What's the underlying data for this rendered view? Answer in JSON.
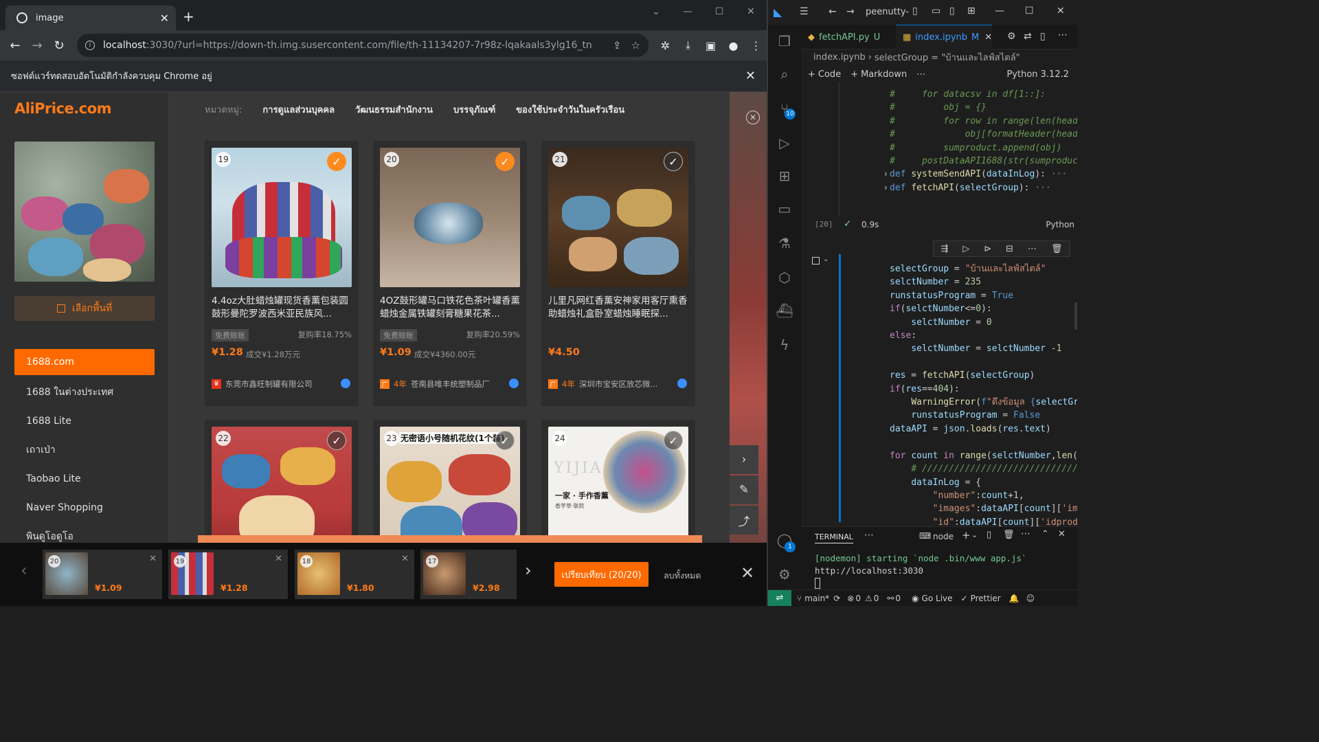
{
  "browser": {
    "tab_title": "image",
    "url_host": "localhost",
    "url_rest": ":3030/?url=https://down-th.img.susercontent.com/file/th-11134207-7r98z-lqakaals3ylg16_tn",
    "automation_notice": "ซอฟต์แวร์ทดสอบอัตโนมัติกำลังควบคุม Chrome อยู่"
  },
  "aliprice": {
    "logo": "AliPrice.com",
    "select_area_label": "เลือกพื้นที่",
    "sources": [
      "1688.com",
      "1688 ในต่างประเทศ",
      "1688 Lite",
      "เถาเป่า",
      "Taobao Lite",
      "Naver Shopping",
      "พินดูโอดูโอ"
    ],
    "category_label": "หมวดหมู่:",
    "categories": [
      "การดูแลส่วนบุคคล",
      "วัฒนธรรมสำนักงาน",
      "บรรจุภัณฑ์",
      "ของใช้ประจำวันในครัวเรือน"
    ],
    "products": [
      {
        "num": "19",
        "checked": true,
        "title": "4.4oz大肚蜡烛罐现货香薰包装圆鼓形曼陀罗波西米亚民族风...",
        "tag": "免费赊账",
        "repurchase": "复购率18.75%",
        "price": "¥1.28",
        "sold": "成交¥1.28万元",
        "seller": "东莞市鑫旺制罐有限公司",
        "years": ""
      },
      {
        "num": "20",
        "checked": true,
        "title": "4OZ鼓形罐马口铁花色茶叶罐香薰蜡烛金属铁罐刻膏糖果花茶...",
        "tag": "免费赊账",
        "repurchase": "复购率20.59%",
        "price": "¥1.09",
        "sold": "成交¥4360.00元",
        "seller": "苍南县唯丰统塑制品厂",
        "years": "4年"
      },
      {
        "num": "21",
        "checked": false,
        "title": "儿里凡网红香薰安神家用客厅熏香助蜡烛礼盒卧室蜡烛睡眠探...",
        "tag": "",
        "repurchase": "",
        "price": "¥4.50",
        "sold": "",
        "seller": "深圳市宝安区放芯微...",
        "years": "4年"
      },
      {
        "num": "22",
        "checked": false
      },
      {
        "num": "23",
        "checked": false,
        "overlay": "无密语小号随机花纹(1个装)"
      },
      {
        "num": "24",
        "checked": false,
        "brand": "YIJIA",
        "slogan": "一家 · 手作香薰",
        "subslogan": "香芋草·联款"
      }
    ],
    "tray": [
      {
        "num": "20",
        "price": "¥1.09"
      },
      {
        "num": "19",
        "price": "¥1.28"
      },
      {
        "num": "18",
        "price": "¥1.80"
      },
      {
        "num": "17",
        "price": "¥2.98"
      }
    ],
    "compare_button": "เปรียบเทียบ (20/20)",
    "clear_all": "ลบทั้งหมด"
  },
  "vscode": {
    "title": "peenutty-",
    "tabs": [
      {
        "label": "fetchAPI.py",
        "status": "U",
        "active": false
      },
      {
        "label": "index.ipynb",
        "status": "M",
        "active": true
      }
    ],
    "breadcrumb_file": "index.ipynb",
    "breadcrumb_symbol": "selectGroup = \"บ้านและไลฟ์สไตล์\"",
    "toolbar_code": "Code",
    "toolbar_markdown": "Markdown",
    "kernel": "Python 3.12.2",
    "cell_exec_count": "[20]",
    "cell_time": "0.9s",
    "cell_lang": "Python",
    "scm_badge": "10",
    "account_badge": "1",
    "terminal_tab": "TERMINAL",
    "terminal_shell": "node",
    "terminal_lines": [
      "[nodemon] starting `node .bin/www app.js`",
      "http://localhost:3030"
    ],
    "status": {
      "branch": "main*",
      "errors": "0",
      "warnings": "0",
      "ports": "0",
      "golive": "Go Live",
      "prettier": "Prettier"
    }
  }
}
